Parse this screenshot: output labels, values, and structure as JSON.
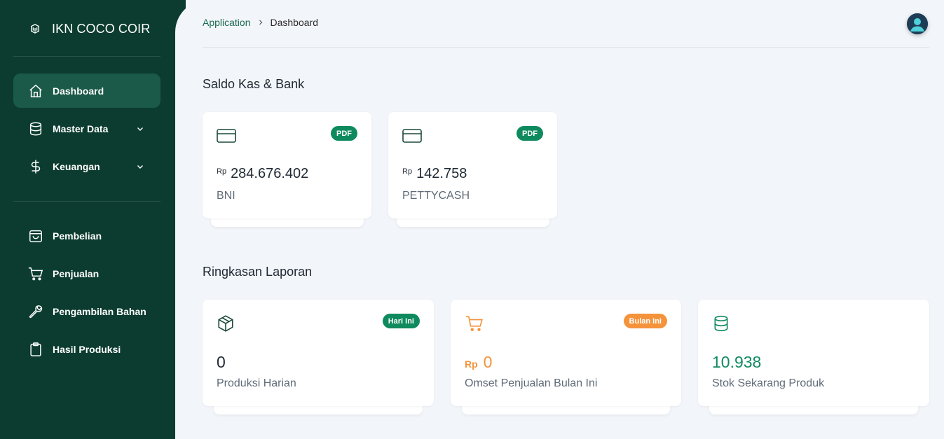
{
  "app": {
    "brand": "IKN COCO COIR"
  },
  "sidebar": {
    "items": [
      {
        "label": "Dashboard",
        "icon": "home-icon",
        "active": true
      },
      {
        "label": "Master Data",
        "icon": "database-icon",
        "expandable": true
      },
      {
        "label": "Keuangan",
        "icon": "dollar-icon",
        "expandable": true
      },
      {
        "label": "Pembelian",
        "icon": "shopping-bag-icon"
      },
      {
        "label": "Penjualan",
        "icon": "cart-icon"
      },
      {
        "label": "Pengambilan Bahan",
        "icon": "wrench-icon"
      },
      {
        "label": "Hasil Produksi",
        "icon": "clipboard-icon"
      }
    ]
  },
  "breadcrumb": {
    "root": "Application",
    "current": "Dashboard"
  },
  "saldo": {
    "title": "Saldo Kas & Bank",
    "cards": [
      {
        "currency": "Rp",
        "amount": "284.676.402",
        "account": "BNI",
        "badge": "PDF",
        "icon": "credit-card-icon"
      },
      {
        "currency": "Rp",
        "amount": "142.758",
        "account": "PETTYCASH",
        "badge": "PDF",
        "icon": "credit-card-icon"
      }
    ]
  },
  "ringkasan": {
    "title": "Ringkasan Laporan",
    "cards": [
      {
        "value": "0",
        "label": "Produksi Harian",
        "badge": "Hari Ini",
        "badge_color": "#0f8a5f",
        "icon": "box-icon",
        "value_color": "#1f2933"
      },
      {
        "currency": "Rp",
        "value": "0",
        "label": "Omset Penjualan Bulan Ini",
        "badge": "Bulan Ini",
        "badge_color": "#f5933b",
        "icon": "cart-icon",
        "value_color": "#f5933b"
      },
      {
        "value": "10.938",
        "label": "Stok Sekarang Produk",
        "icon": "database-icon",
        "value_color": "#0f8a5f"
      }
    ]
  },
  "colors": {
    "sidebar": "#0b3c2f",
    "active": "#1b5a48",
    "accent_green": "#0f8a5f",
    "accent_orange": "#f5933b",
    "background": "#f2f5f9"
  }
}
